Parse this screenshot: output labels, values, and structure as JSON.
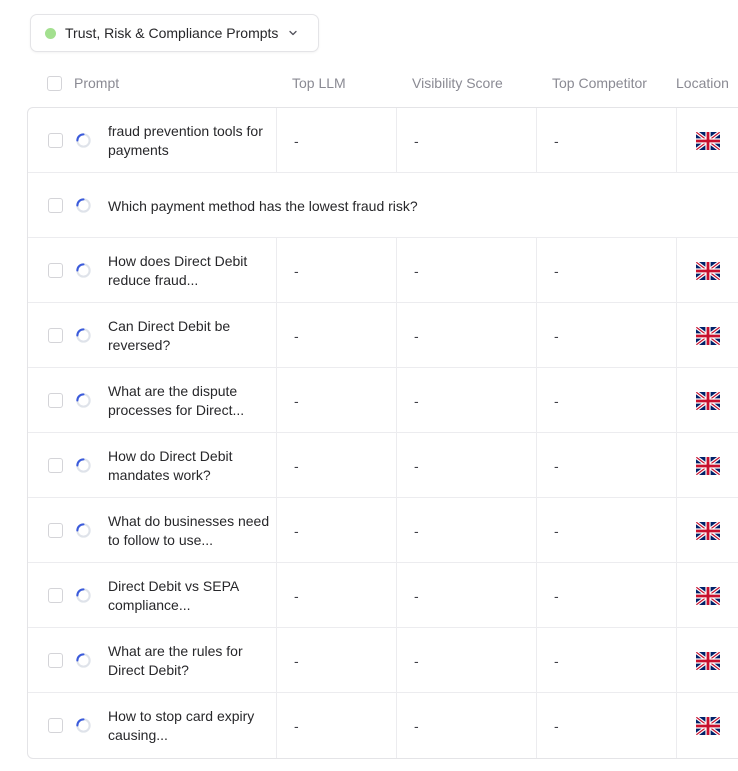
{
  "filter": {
    "label": "Trust, Risk & Compliance Prompts",
    "dot_color": "#a3e08f"
  },
  "columns": {
    "prompt": "Prompt",
    "top_llm": "Top LLM",
    "visibility_score": "Visibility Score",
    "top_competitor": "Top Competitor",
    "location": "Location"
  },
  "rows": [
    {
      "prompt": "fraud prevention tools for payments",
      "top_llm": "-",
      "visibility_score": "-",
      "top_competitor": "-",
      "location_icon": "uk-flag-icon"
    },
    {
      "prompt": "Which payment method has the lowest fraud risk?"
    },
    {
      "prompt": "How does Direct Debit reduce fraud...",
      "top_llm": "-",
      "visibility_score": "-",
      "top_competitor": "-",
      "location_icon": "uk-flag-icon"
    },
    {
      "prompt": "Can Direct Debit be reversed?",
      "top_llm": "-",
      "visibility_score": "-",
      "top_competitor": "-",
      "location_icon": "uk-flag-icon"
    },
    {
      "prompt": "What are the dispute processes for Direct...",
      "top_llm": "-",
      "visibility_score": "-",
      "top_competitor": "-",
      "location_icon": "uk-flag-icon"
    },
    {
      "prompt": "How do Direct Debit mandates work?",
      "top_llm": "-",
      "visibility_score": "-",
      "top_competitor": "-",
      "location_icon": "uk-flag-icon"
    },
    {
      "prompt": "What do businesses need to follow to use...",
      "top_llm": "-",
      "visibility_score": "-",
      "top_competitor": "-",
      "location_icon": "uk-flag-icon"
    },
    {
      "prompt": "Direct Debit vs SEPA compliance...",
      "top_llm": "-",
      "visibility_score": "-",
      "top_competitor": "-",
      "location_icon": "uk-flag-icon"
    },
    {
      "prompt": "What are the rules for Direct Debit?",
      "top_llm": "-",
      "visibility_score": "-",
      "top_competitor": "-",
      "location_icon": "uk-flag-icon"
    },
    {
      "prompt": "How to stop card expiry causing...",
      "top_llm": "-",
      "visibility_score": "-",
      "top_competitor": "-",
      "location_icon": "uk-flag-icon"
    }
  ],
  "colors": {
    "spinner": "#3b5bdb",
    "flag_blue": "#012169",
    "flag_red": "#C8102E"
  }
}
